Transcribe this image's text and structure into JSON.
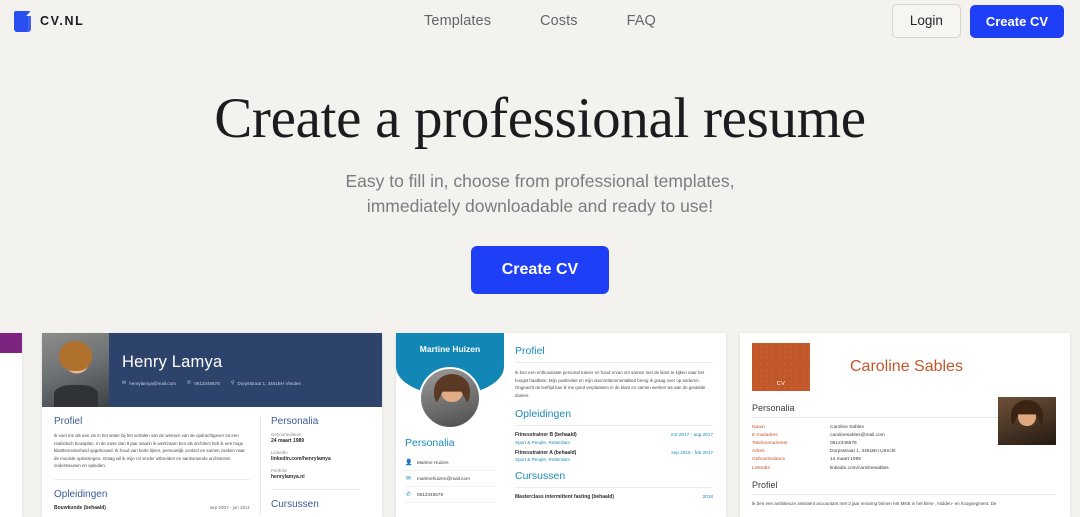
{
  "brand": {
    "name": "CV.NL",
    "icon": "document-icon",
    "color": "#2a4ff0"
  },
  "nav": {
    "items": [
      {
        "label": "Templates"
      },
      {
        "label": "Costs"
      },
      {
        "label": "FAQ"
      }
    ]
  },
  "actions": {
    "login": "Login",
    "create": "Create CV"
  },
  "hero": {
    "title": "Create a professional resume",
    "subtitle_line1": "Easy to fill in, choose from professional templates,",
    "subtitle_line2": "immediately downloadable and ready to use!",
    "cta": "Create CV",
    "accent": "#1e3ff5"
  },
  "carousel": {
    "cards": [
      {
        "name": "Henry Lamya",
        "accent": "#2e436b",
        "email": "henrylamya@mail.com",
        "phone": "0612345678",
        "address": "Dorpsstraat 1, 3451BH Vleuten",
        "profiel_heading": "Profiel",
        "profiel_text": "Ik voel me als een vis in het water bij het vertalen van de wensen van de opdrachtgever tot een realistisch bouwplan. In de meer dan 9 jaar waarin ik werkzaam ben als architect heb ik een hoge klanttevredenheid opgebouwd. Ik houd van korte lijnen, persoonlijk contact en samen zoeken naar de mooiste oplossingen. Graag wil ik mijn rol verder uitbreiden en aankomende architecten ondersteunen en opleiden.",
        "opleidingen_heading": "Opleidingen",
        "opleiding_title": "Bouwkunde (behaald)",
        "opleiding_date": "sep 2007 - jun 2011",
        "personalia_heading": "Personalia",
        "fields": [
          {
            "label": "Geboortedatum",
            "value": "24 maart 1989"
          },
          {
            "label": "LinkedIn",
            "value": "linkedin.com/henrylamya"
          },
          {
            "label": "Portfolio",
            "value": "henrylamya.nl"
          }
        ],
        "cursussen_heading": "Cursussen"
      },
      {
        "name": "Martine Huizen",
        "accent": "#1287b5",
        "personalia_heading": "Personalia",
        "contacts": [
          {
            "icon": "person-icon",
            "value": "Martine Huizen"
          },
          {
            "icon": "mail-icon",
            "value": "martinehuizen@mail.com"
          },
          {
            "icon": "phone-icon",
            "value": "0612345678"
          }
        ],
        "profiel_heading": "Profiel",
        "profiel_text": "Ik ben een enthousiaste personal trainer en houd ervan om samen met de klant te kijken naar het hoogst haalbare. Mijn positiviteit en mijn doorzettersmentaliteit breng ik graag over op anderen. Ongeacht de leeftijd kan ik me goed verplaatsen in de klant en samen werken we aan de gestelde doelen.",
        "opleidingen_heading": "Opleidingen",
        "opleidingen": [
          {
            "title": "Fitnesstrainer B (behaald)",
            "sub": "Sport & People, Rotterdam",
            "date": "mrt 2017 - aug 2017"
          },
          {
            "title": "Fitnesstrainer A (behaald)",
            "sub": "Sport & People, Rotterdam",
            "date": "sep 2016 - feb 2017"
          }
        ],
        "cursussen_heading": "Cursussen",
        "cursus_title": "Masterclass intermittent fasting (behaald)",
        "cursus_date": "2018"
      },
      {
        "name": "Caroline Sables",
        "accent": "#c2572a",
        "logo_text": "CV",
        "personalia_heading": "Personalia",
        "fields": [
          {
            "label": "Naam",
            "value": "Caroline Sables"
          },
          {
            "label": "E-mailadres",
            "value": "carolinesables@mail.com"
          },
          {
            "label": "Telefoonnummer",
            "value": "0612345678"
          },
          {
            "label": "Adres",
            "value": "Dorpsstraat 1, 3451BH Utrecht"
          },
          {
            "label": "Geboortedatum",
            "value": "14 maart 1995"
          },
          {
            "label": "LinkedIn",
            "value": "linkedin.com/carolinesables"
          }
        ],
        "profiel_heading": "Profiel",
        "profiel_text": "Ik ben een ambitieuze assistent accountant met 3 jaar ervaring binnen het MKB in het klein-, midden- en hoogsegment. De"
      }
    ]
  }
}
